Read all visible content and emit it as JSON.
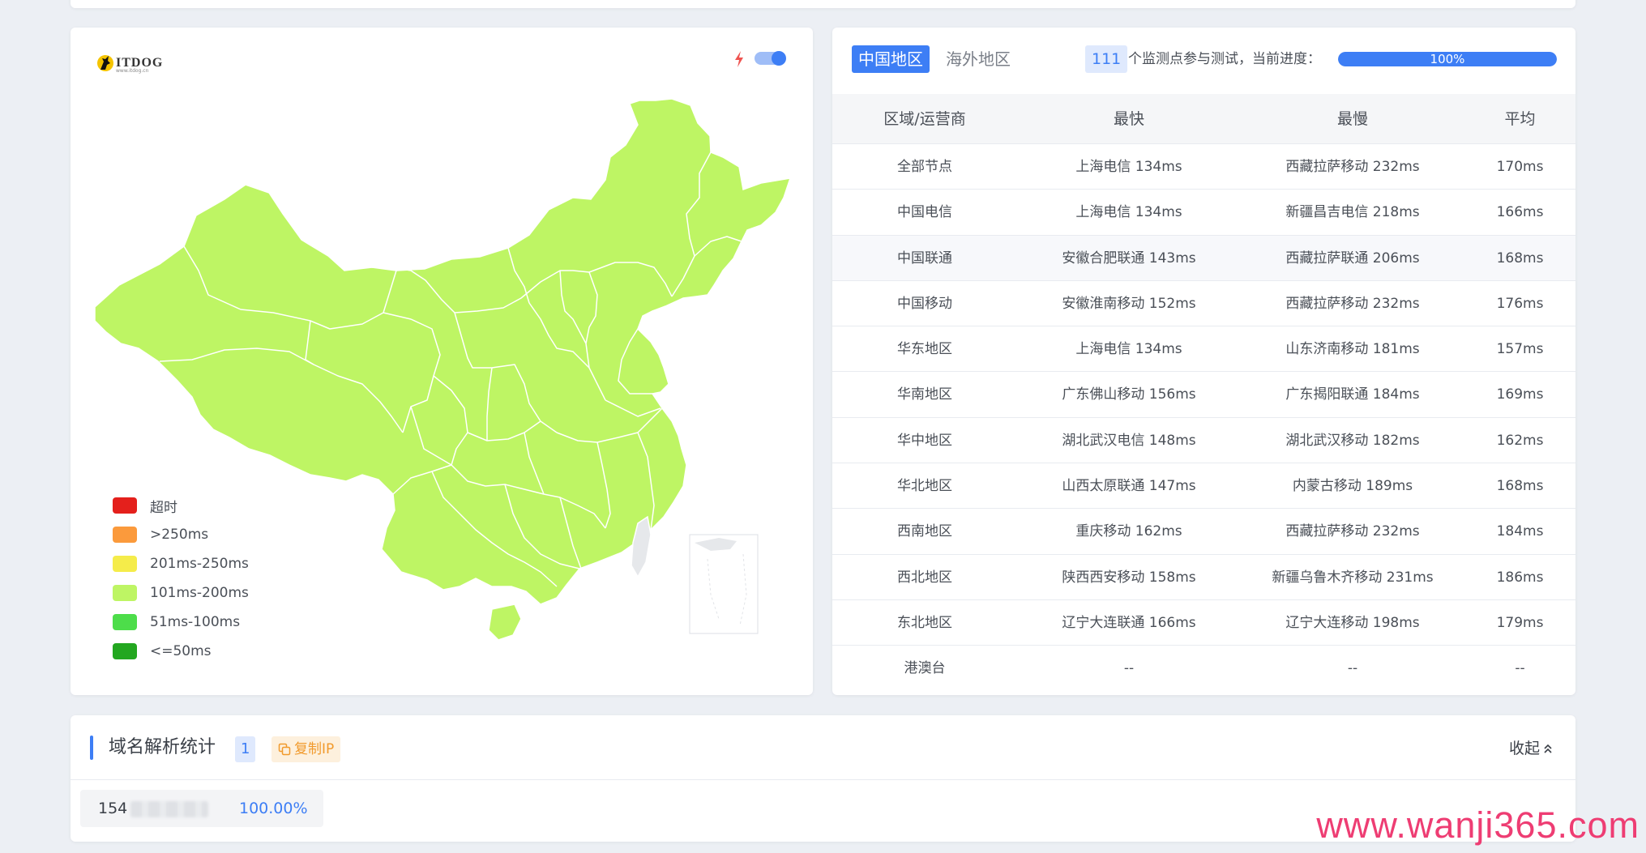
{
  "map_card": {
    "logo_text": "ITDOG",
    "logo_sub": "www.itdog.cn",
    "toggle_on": true,
    "legend": [
      {
        "label": "超时",
        "color": "#e4201c"
      },
      {
        "label": ">250ms",
        "color": "#fb9a3c"
      },
      {
        "label": "201ms-250ms",
        "color": "#f5ec4a"
      },
      {
        "label": "101ms-200ms",
        "color": "#bef564"
      },
      {
        "label": "51ms-100ms",
        "color": "#4ddd4a"
      },
      {
        "label": "<=50ms",
        "color": "#23a720"
      }
    ]
  },
  "stats": {
    "tabs": [
      "中国地区",
      "海外地区"
    ],
    "active_tab": "中国地区",
    "node_count": "111",
    "node_text": "个监测点参与测试，当前进度：",
    "progress": 1.0,
    "progress_label": "100%",
    "headers": [
      "区域/运营商",
      "最快",
      "最慢",
      "平均"
    ],
    "rows": [
      {
        "region": "全部节点",
        "fastest": "上海电信 134ms",
        "slowest": "西藏拉萨移动 232ms",
        "average": "170ms"
      },
      {
        "region": "中国电信",
        "fastest": "上海电信 134ms",
        "slowest": "新疆昌吉电信 218ms",
        "average": "166ms"
      },
      {
        "region": "中国联通",
        "fastest": "安徽合肥联通 143ms",
        "slowest": "西藏拉萨联通 206ms",
        "average": "168ms"
      },
      {
        "region": "中国移动",
        "fastest": "安徽淮南移动 152ms",
        "slowest": "西藏拉萨移动 232ms",
        "average": "176ms"
      },
      {
        "region": "华东地区",
        "fastest": "上海电信 134ms",
        "slowest": "山东济南移动 181ms",
        "average": "157ms"
      },
      {
        "region": "华南地区",
        "fastest": "广东佛山移动 156ms",
        "slowest": "广东揭阳联通 184ms",
        "average": "169ms"
      },
      {
        "region": "华中地区",
        "fastest": "湖北武汉电信 148ms",
        "slowest": "湖北武汉移动 182ms",
        "average": "162ms"
      },
      {
        "region": "华北地区",
        "fastest": "山西太原联通 147ms",
        "slowest": "内蒙古移动 189ms",
        "average": "168ms"
      },
      {
        "region": "西南地区",
        "fastest": "重庆移动 162ms",
        "slowest": "西藏拉萨移动 232ms",
        "average": "184ms"
      },
      {
        "region": "西北地区",
        "fastest": "陕西西安移动 158ms",
        "slowest": "新疆乌鲁木齐移动 231ms",
        "average": "186ms"
      },
      {
        "region": "东北地区",
        "fastest": "辽宁大连联通 166ms",
        "slowest": "辽宁大连移动 198ms",
        "average": "179ms"
      },
      {
        "region": "港澳台",
        "fastest": "--",
        "slowest": "--",
        "average": "--"
      }
    ]
  },
  "dns": {
    "title": "域名解析统计",
    "count": "1",
    "copy_label": "复制IP",
    "collapse_label": "收起",
    "ip_prefix": "154",
    "ip_percent": "100.00%"
  },
  "watermark": "www.wanji365.com"
}
